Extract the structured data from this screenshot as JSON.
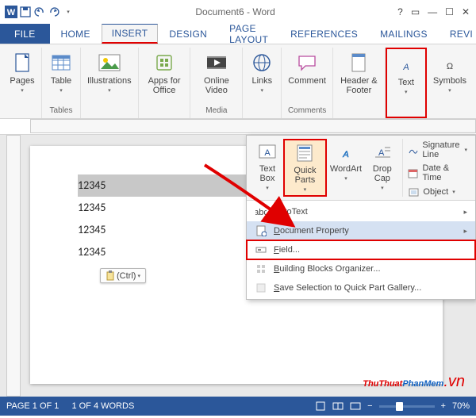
{
  "title": "Document6 - Word",
  "qat": {
    "word": "W",
    "save": "save",
    "undo": "undo",
    "redo": "redo"
  },
  "tabs": {
    "file": "FILE",
    "home": "HOME",
    "insert": "INSERT",
    "design": "DESIGN",
    "pagelayout": "PAGE LAYOUT",
    "references": "REFERENCES",
    "mailings": "MAILINGS",
    "review": "REVI"
  },
  "ribbon": {
    "pages": "Pages",
    "table": "Table",
    "illustrations": "Illustrations",
    "apps": "Apps for Office",
    "video": "Online Video",
    "links": "Links",
    "comment": "Comment",
    "header": "Header & Footer",
    "text": "Text",
    "symbols": "Symbols",
    "grp_tables": "Tables",
    "grp_media": "Media",
    "grp_comments": "Comments"
  },
  "popup": {
    "textbox": "Text Box",
    "quickparts": "Quick Parts",
    "wordart": "WordArt",
    "dropcap": "Drop Cap",
    "sig": "Signature Line",
    "date": "Date & Time",
    "obj": "Object",
    "autotext": "AutoText",
    "docprop": "Document Property",
    "field": "Field...",
    "bbo": "Building Blocks Organizer...",
    "savesel": "Save Selection to Quick Part Gallery..."
  },
  "doc": {
    "l1": "12345",
    "l2": "12345",
    "l3": "12345",
    "l4": "12345",
    "paste": "(Ctrl)"
  },
  "status": {
    "page": "PAGE 1 OF 1",
    "words": "1 OF 4 WORDS",
    "zoom": "70%",
    "minus": "−",
    "plus": "+"
  },
  "watermark": {
    "a": "ThuThuat",
    "b": "PhanMem",
    "c": ".vn"
  }
}
